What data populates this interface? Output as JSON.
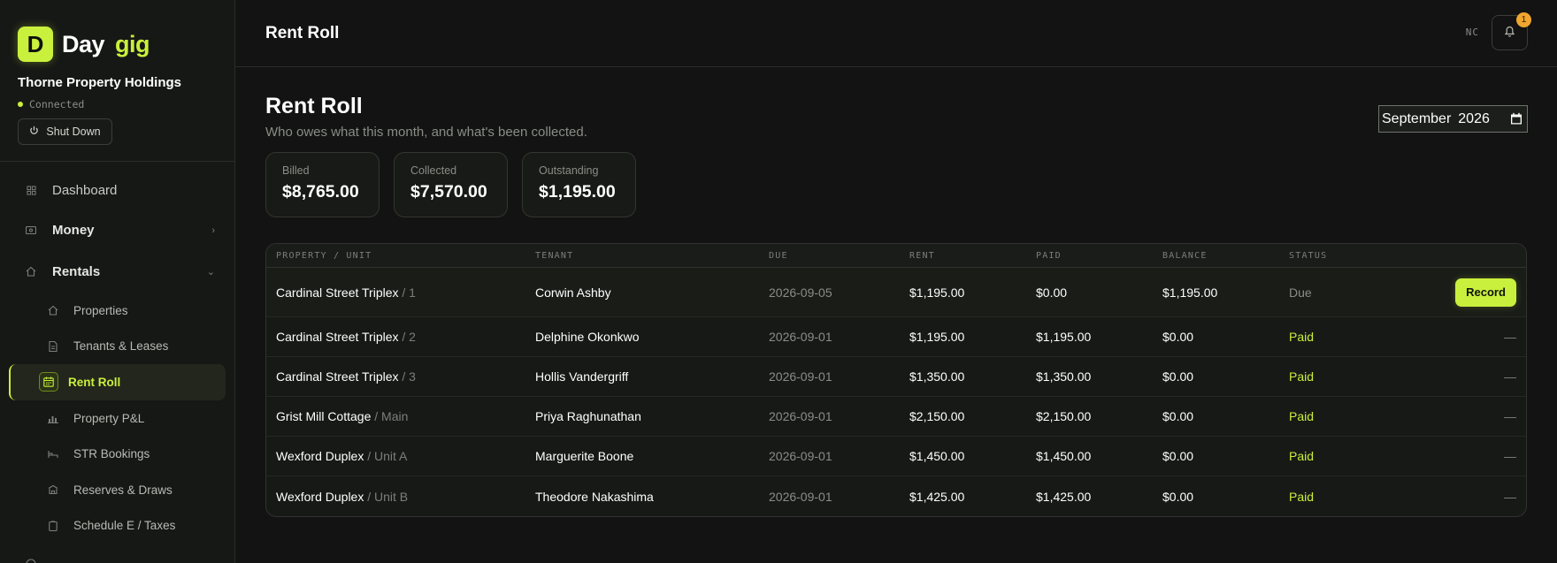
{
  "brand": {
    "logo_letter": "D",
    "word1": "Day",
    "word2": "gig",
    "accent": "#c9f03c"
  },
  "org": {
    "name": "Thorne Property Holdings",
    "status": "Connected",
    "shutdown_label": "Shut Down"
  },
  "nav": {
    "dashboard": {
      "label": "Dashboard",
      "icon": "dashboard-icon"
    },
    "money": {
      "label": "Money",
      "icon": "money-icon"
    },
    "rentals": {
      "label": "Rentals",
      "icon": "home-icon"
    },
    "sub": [
      {
        "label": "Properties",
        "icon": "home-icon"
      },
      {
        "label": "Tenants & Leases",
        "icon": "document-icon"
      },
      {
        "label": "Rent Roll",
        "icon": "calendar-icon",
        "active": true
      },
      {
        "label": "Property P&L",
        "icon": "bar-chart-icon"
      },
      {
        "label": "STR Bookings",
        "icon": "bed-icon"
      },
      {
        "label": "Reserves & Draws",
        "icon": "bank-icon"
      },
      {
        "label": "Schedule E / Taxes",
        "icon": "clipboard-icon"
      }
    ]
  },
  "topbar": {
    "title": "Rent Roll",
    "initials": "NC",
    "notification_count": "1"
  },
  "page": {
    "title": "Rent Roll",
    "subtitle": "Who owes what this month, and what's been collected.",
    "month": "September",
    "year": "2026"
  },
  "stats": [
    {
      "label": "Billed",
      "value": "$8,765.00"
    },
    {
      "label": "Collected",
      "value": "$7,570.00"
    },
    {
      "label": "Outstanding",
      "value": "$1,195.00"
    }
  ],
  "table": {
    "headers": [
      "Property / Unit",
      "Tenant",
      "Due",
      "Rent",
      "Paid",
      "Balance",
      "Status"
    ],
    "rows": [
      {
        "property": "Cardinal Street Triplex",
        "unit": "/ 1",
        "tenant": "Corwin Ashby",
        "due": "2026-09-05",
        "rent": "$1,195.00",
        "paid": "$0.00",
        "balance": "$1,195.00",
        "status": "Due",
        "action": "Record"
      },
      {
        "property": "Cardinal Street Triplex",
        "unit": "/ 2",
        "tenant": "Delphine Okonkwo",
        "due": "2026-09-01",
        "rent": "$1,195.00",
        "paid": "$1,195.00",
        "balance": "$0.00",
        "status": "Paid",
        "action": "—"
      },
      {
        "property": "Cardinal Street Triplex",
        "unit": "/ 3",
        "tenant": "Hollis Vandergriff",
        "due": "2026-09-01",
        "rent": "$1,350.00",
        "paid": "$1,350.00",
        "balance": "$0.00",
        "status": "Paid",
        "action": "—"
      },
      {
        "property": "Grist Mill Cottage",
        "unit": "/ Main",
        "tenant": "Priya Raghunathan",
        "due": "2026-09-01",
        "rent": "$2,150.00",
        "paid": "$2,150.00",
        "balance": "$0.00",
        "status": "Paid",
        "action": "—"
      },
      {
        "property": "Wexford Duplex",
        "unit": "/ Unit A",
        "tenant": "Marguerite Boone",
        "due": "2026-09-01",
        "rent": "$1,450.00",
        "paid": "$1,450.00",
        "balance": "$0.00",
        "status": "Paid",
        "action": "—"
      },
      {
        "property": "Wexford Duplex",
        "unit": "/ Unit B",
        "tenant": "Theodore Nakashima",
        "due": "2026-09-01",
        "rent": "$1,425.00",
        "paid": "$1,425.00",
        "balance": "$0.00",
        "status": "Paid",
        "action": "—"
      }
    ]
  }
}
